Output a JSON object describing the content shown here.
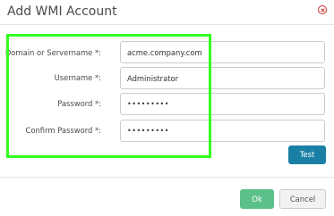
{
  "dialog": {
    "title": "Add WMI Account"
  },
  "form": {
    "domain": {
      "label": "Domain or Servername *:",
      "value": "acme.company.com"
    },
    "username": {
      "label": "Username *:",
      "value": "Administrator"
    },
    "password": {
      "label": "Password *:",
      "value": "•••••••••"
    },
    "confirm_password": {
      "label": "Confirm Password *:",
      "value": "•••••••••"
    }
  },
  "buttons": {
    "test_label": "Test",
    "ok_label": "Ok",
    "cancel_label": "Cancel"
  },
  "colors": {
    "highlight": "#33ff1f",
    "test_button": "#1a7fa4",
    "ok_button": "#5cc08a",
    "close_icon": "#c9302c"
  },
  "icons": {
    "close": "close-icon"
  }
}
